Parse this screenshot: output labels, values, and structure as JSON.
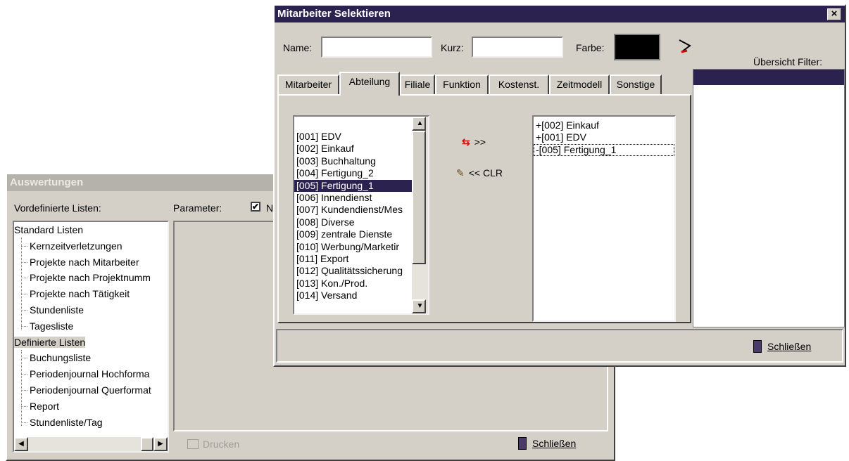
{
  "auswertungen": {
    "title": "Auswertungen",
    "predefined_label": "Vordefinierte Listen:",
    "parameter_label": "Parameter:",
    "parameter_checkbox_text": "N",
    "tree": {
      "group1": "Standard Listen",
      "group1_items": [
        "Kernzeitverletzungen",
        "Projekte nach Mitarbeiter",
        "Projekte nach Projektnumm",
        "Projekte nach Tätigkeit",
        "Stundenliste",
        "Tagesliste"
      ],
      "group2": "Definierte Listen",
      "group2_items": [
        "Buchungsliste",
        "Periodenjournal Hochforma",
        "Periodenjournal Querformat",
        "Report",
        "Stundenliste/Tag"
      ]
    },
    "print_label": "Drucken",
    "close_label": "Schließen"
  },
  "mitarbeiter": {
    "title": "Mitarbeiter Selektieren",
    "close_x": "×",
    "name_label": "Name:",
    "name_value": "",
    "kurz_label": "Kurz:",
    "kurz_value": "",
    "farbe_label": "Farbe:",
    "farbe_color": "#000000",
    "filter_label": "Übersicht Filter:",
    "tabs": [
      "Mitarbeiter",
      "Abteilung",
      "Filiale",
      "Funktion",
      "Kostenst.",
      "Zeitmodell",
      "Sonstige"
    ],
    "active_tab": "Abteilung",
    "departments": [
      "[001] EDV",
      "[002] Einkauf",
      "[003] Buchhaltung",
      "[004] Fertigung_2",
      "[005] Fertigung_1",
      "[006] Innendienst",
      "[007] Kundendienst/Mes",
      "[008] Diverse",
      "[009] zentrale Dienste",
      "[010] Werbung/Marketir",
      "[011] Export",
      "[012] Qualitätssicherung",
      "[013] Kon./Prod.",
      "[014] Versand"
    ],
    "selected_department": "[005] Fertigung_1",
    "add_label": ">>",
    "clear_label": "<< CLR",
    "selected_list": [
      "+[002] Einkauf",
      "+[001] EDV",
      "-[005] Fertigung_1"
    ],
    "close_label": "Schließen"
  },
  "colors": {
    "title_active": "#2c2250",
    "title_inactive": "#b5b2ab",
    "face": "#d4d0c8"
  }
}
